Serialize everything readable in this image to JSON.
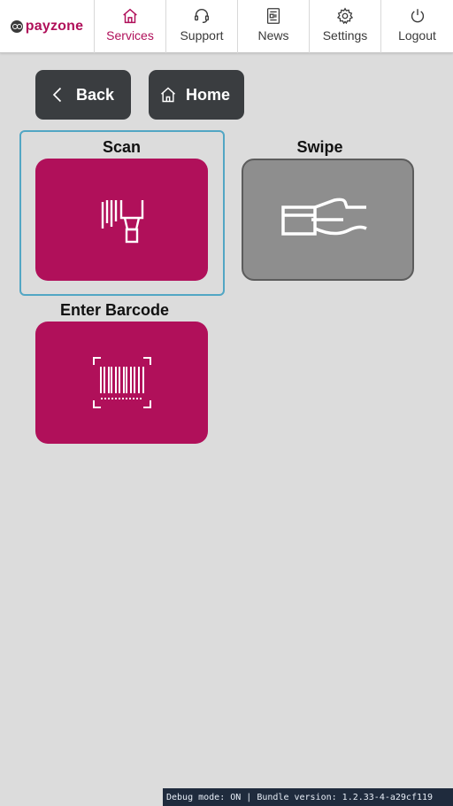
{
  "brand": {
    "name": "payzone"
  },
  "nav": {
    "items": [
      {
        "label": "Services",
        "icon": "home-icon",
        "active": true
      },
      {
        "label": "Support",
        "icon": "headset-icon",
        "active": false
      },
      {
        "label": "News",
        "icon": "newspaper-icon",
        "active": false
      },
      {
        "label": "Settings",
        "icon": "gear-icon",
        "active": false
      },
      {
        "label": "Logout",
        "icon": "power-icon",
        "active": false
      }
    ]
  },
  "actions": {
    "back_label": "Back",
    "home_label": "Home"
  },
  "tiles": [
    {
      "title": "Scan",
      "icon": "barcode-scanner-icon",
      "color": "#b0105a",
      "selected": true
    },
    {
      "title": "Swipe",
      "icon": "card-swipe-icon",
      "color": "#8e8e8e",
      "selected": false
    },
    {
      "title": "Enter Barcode",
      "icon": "barcode-icon",
      "color": "#b0105a",
      "selected": false
    }
  ],
  "footer": {
    "debug_text": "Debug mode: ON | Bundle version: 1.2.33-4-a29cf119"
  },
  "colors": {
    "accent": "#b0105a",
    "background": "#dcdcdc",
    "button_dark": "#3a3d40",
    "selection_border": "#52a6c4"
  }
}
